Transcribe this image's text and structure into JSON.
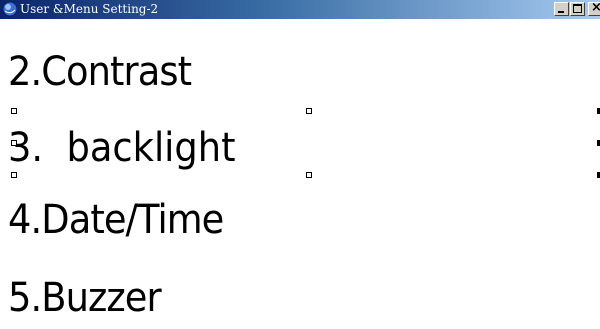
{
  "window": {
    "title": "User &Menu Setting-2",
    "icon": "app-globe-icon",
    "controls": {
      "minimize": "minimize-icon",
      "maximize": "maximize-icon",
      "close": "close-icon"
    }
  },
  "menu": {
    "items": [
      {
        "label": "2.Contrast"
      },
      {
        "label": "3.  backlight",
        "selected": true
      },
      {
        "label": "4.Date/Time"
      },
      {
        "label": "5.Buzzer"
      }
    ]
  }
}
